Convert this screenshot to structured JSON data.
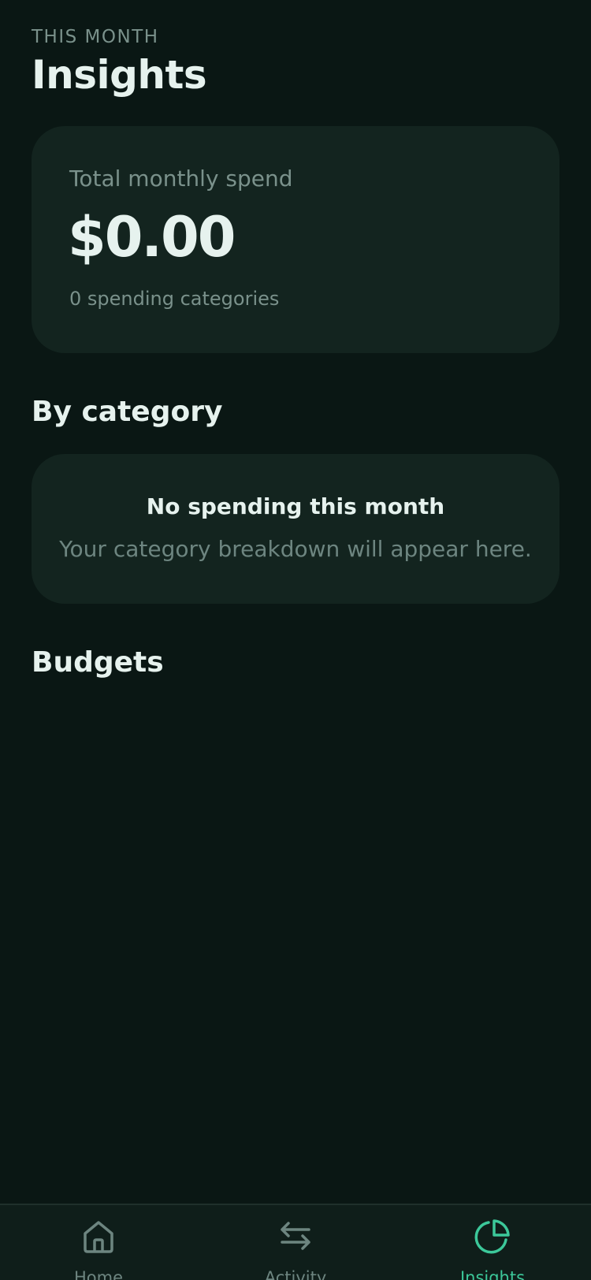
{
  "header": {
    "eyebrow": "THIS MONTH",
    "title": "Insights"
  },
  "summary": {
    "label": "Total monthly spend",
    "amount": "$0.00",
    "meta": "0 spending categories"
  },
  "by_category": {
    "title": "By category",
    "empty_title": "No spending this month",
    "empty_subtitle": "Your category breakdown will appear here."
  },
  "budgets": {
    "title": "Budgets"
  },
  "tabbar": {
    "items": [
      {
        "label": "Home",
        "icon": "home-icon",
        "active": false
      },
      {
        "label": "Activity",
        "icon": "swap-arrows-icon",
        "active": false
      },
      {
        "label": "Insights",
        "icon": "pie-chart-icon",
        "active": true
      }
    ]
  },
  "colors": {
    "background": "#0a1714",
    "card": "#13241f",
    "accent": "#3cc89a",
    "muted_text": "#7a918b",
    "primary_text": "#e6f2ee"
  }
}
